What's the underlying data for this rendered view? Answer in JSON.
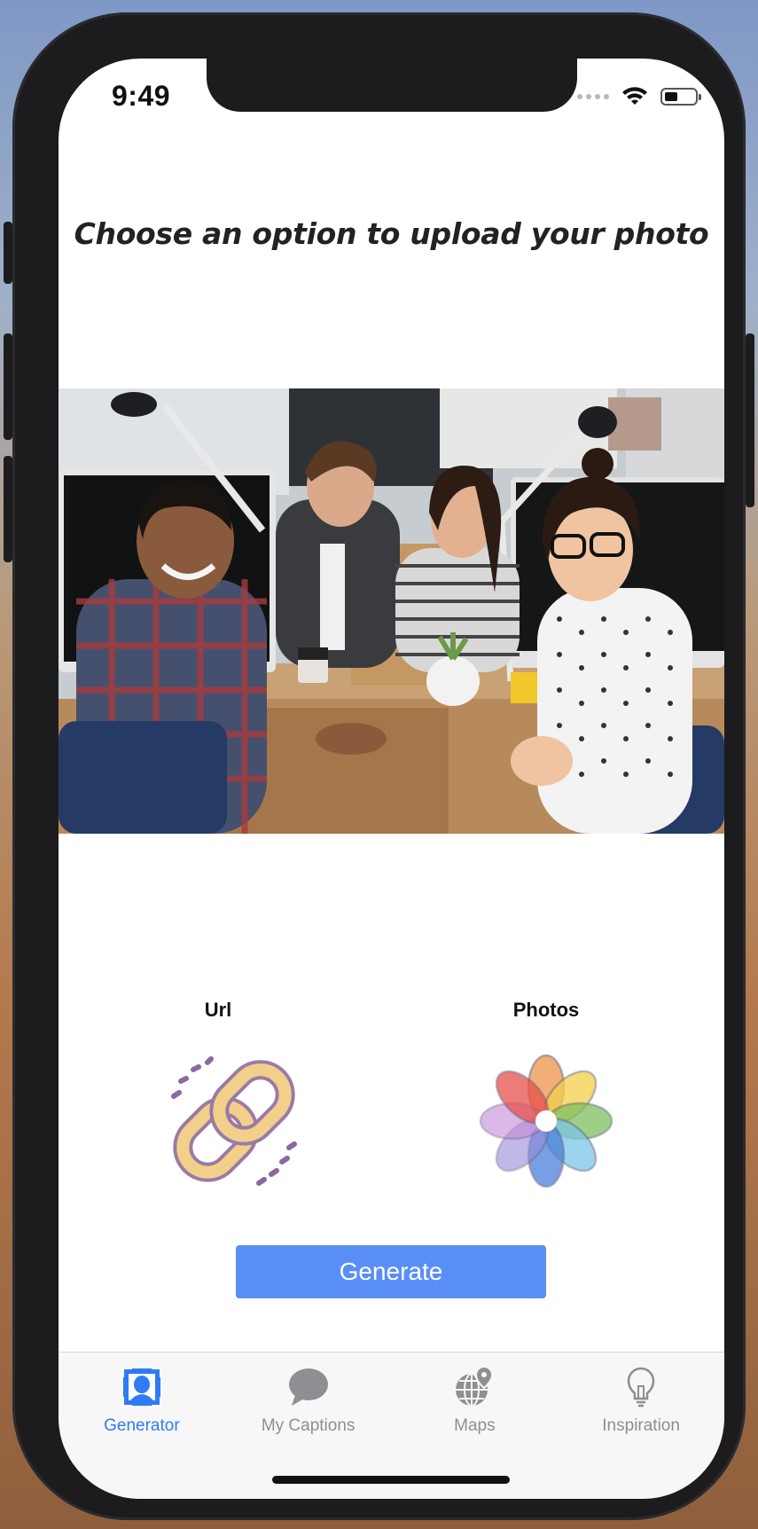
{
  "status_bar": {
    "time": "9:49"
  },
  "page": {
    "heading": "Choose an option to upload your photo"
  },
  "options": {
    "url_label": "Url",
    "photos_label": "Photos"
  },
  "generate_button": {
    "label": "Generate"
  },
  "tab_bar": {
    "items": [
      {
        "label": "Generator",
        "icon": "face-scan-icon",
        "active": true
      },
      {
        "label": "My Captions",
        "icon": "speech-bubble-icon",
        "active": false
      },
      {
        "label": "Maps",
        "icon": "globe-pin-icon",
        "active": false
      },
      {
        "label": "Inspiration",
        "icon": "lightbulb-icon",
        "active": false
      }
    ]
  },
  "colors": {
    "accent": "#2f7bf3",
    "button": "#5a8ef7",
    "tab_inactive": "#8e8e93"
  }
}
